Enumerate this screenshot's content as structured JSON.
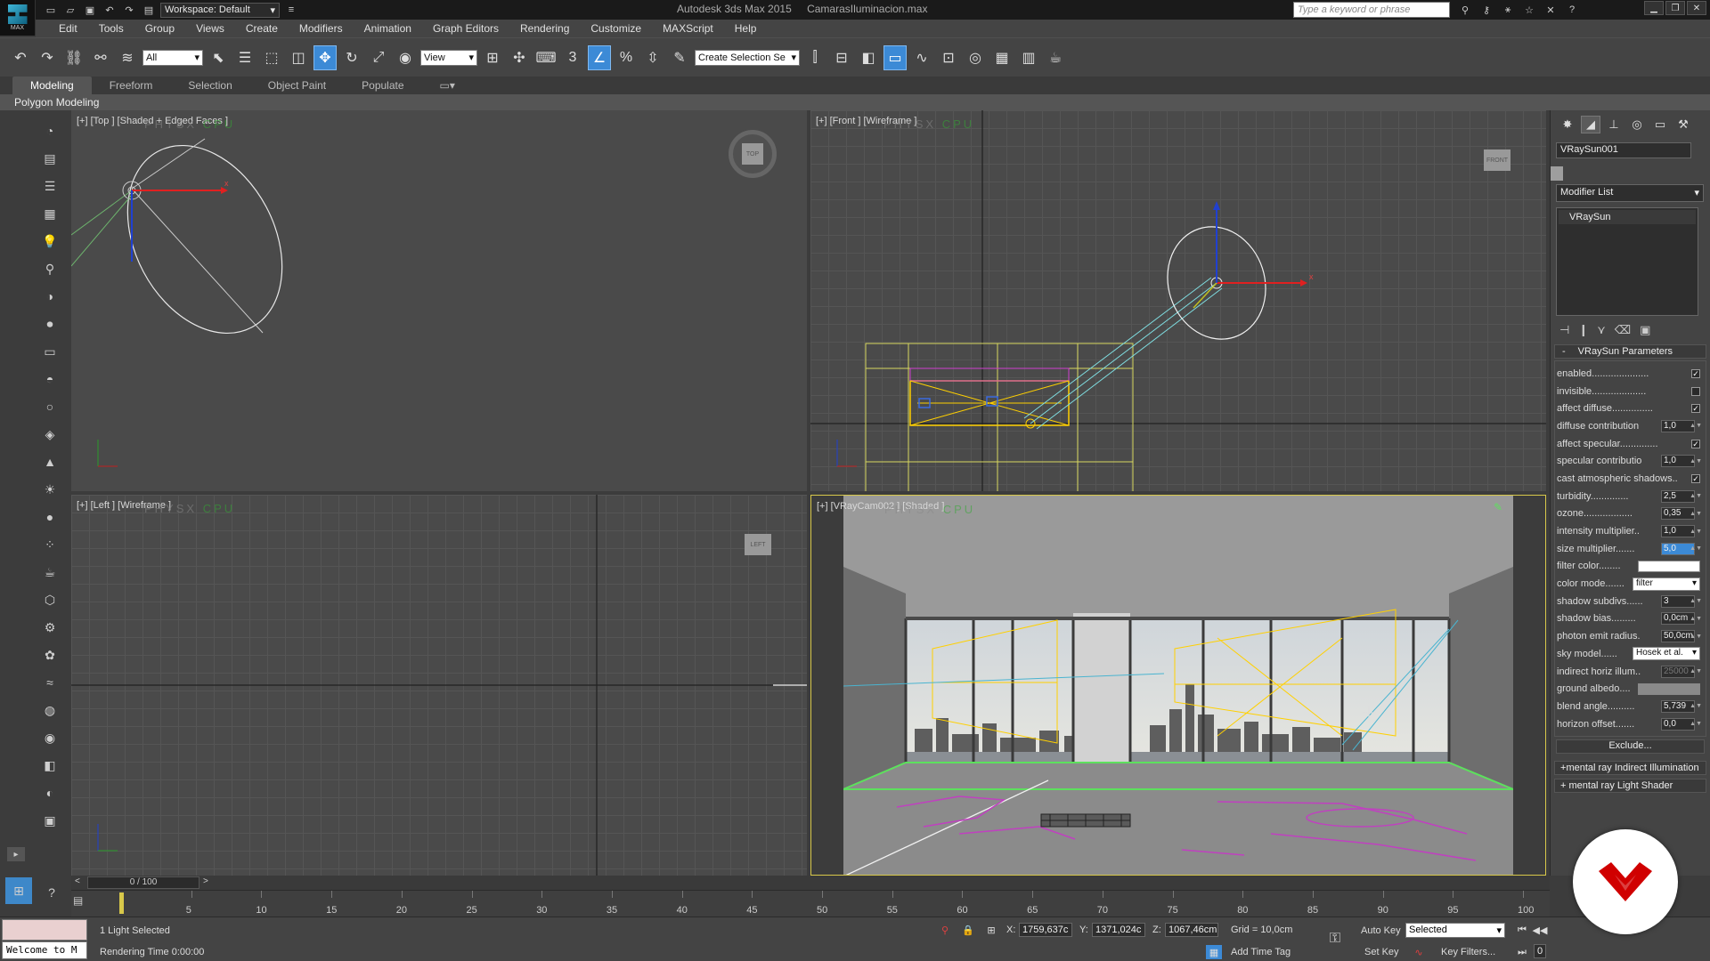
{
  "app": {
    "logo_text": "MAX",
    "title": "Autodesk 3ds Max 2015",
    "filename": "CamarasIluminacion.max",
    "workspace_label": "Workspace: Default",
    "search_placeholder": "Type a keyword or phrase"
  },
  "menu": [
    "Edit",
    "Tools",
    "Group",
    "Views",
    "Create",
    "Modifiers",
    "Animation",
    "Graph Editors",
    "Rendering",
    "Customize",
    "MAXScript",
    "Help"
  ],
  "toolbar": {
    "selection_filter": "All",
    "ref_coord": "View",
    "named_selection": "Create Selection Se"
  },
  "ribbon": {
    "tabs": [
      "Modeling",
      "Freeform",
      "Selection",
      "Object Paint",
      "Populate"
    ],
    "active_tab": "Modeling",
    "panel_label": "Polygon Modeling"
  },
  "viewports": {
    "top": {
      "label": "[+] [Top ] [Shaded + Edged Faces ]",
      "cube": "TOP"
    },
    "front": {
      "label": "[+] [Front ] [Wireframe ]",
      "cube": "FRONT"
    },
    "left": {
      "label": "[+] [Left ] [Wireframe ]",
      "cube": "LEFT"
    },
    "camera": {
      "label": "[+] [VRayCam002 ] [Shaded ]"
    },
    "physx_text": "PHYSX",
    "physx_cpu": "CPU"
  },
  "command_panel": {
    "object_name": "VRaySun001",
    "modifier_list": "Modifier List",
    "stack_item": "VRaySun",
    "rollout_title": "VRaySun Parameters",
    "params": [
      {
        "label": "enabled.....................",
        "type": "check",
        "checked": true
      },
      {
        "label": "invisible....................",
        "type": "check",
        "checked": false
      },
      {
        "label": "affect diffuse...............",
        "type": "check",
        "checked": true
      },
      {
        "label": "diffuse contribution",
        "type": "spin",
        "value": "1,0"
      },
      {
        "label": "affect specular..............",
        "type": "check",
        "checked": true
      },
      {
        "label": "specular contributio",
        "type": "spin",
        "value": "1,0"
      },
      {
        "label": "cast atmospheric shadows..",
        "type": "check",
        "checked": true
      },
      {
        "label": "turbidity..............",
        "type": "spin",
        "value": "2,5"
      },
      {
        "label": "ozone..................",
        "type": "spin",
        "value": "0,35"
      },
      {
        "label": "intensity multiplier..",
        "type": "spin",
        "value": "1,0"
      },
      {
        "label": "size multiplier.......",
        "type": "spin",
        "value": "5,0",
        "highlight": true
      },
      {
        "label": "filter color........",
        "type": "swatch",
        "color": "#ffffff"
      },
      {
        "label": "color mode.......",
        "type": "dropdown",
        "value": "filter"
      },
      {
        "label": "shadow subdivs......",
        "type": "spin",
        "value": "3"
      },
      {
        "label": "shadow bias.........",
        "type": "spin",
        "value": "0,0cm"
      },
      {
        "label": "photon emit radius.",
        "type": "spin",
        "value": "50,0cm"
      },
      {
        "label": "sky model......",
        "type": "dropdown",
        "value": "Hosek et al."
      },
      {
        "label": "indirect horiz illum..",
        "type": "spin",
        "value": "25000",
        "dim": true
      },
      {
        "label": "ground albedo....",
        "type": "swatch",
        "color": "#8a8a8a"
      },
      {
        "label": "blend angle..........",
        "type": "spin",
        "value": "5,739"
      },
      {
        "label": "horizon offset.......",
        "type": "spin",
        "value": "0,0"
      }
    ],
    "exclude_label": "Exclude...",
    "subrollouts": [
      "mental ray Indirect Illumination",
      "mental ray Light Shader"
    ]
  },
  "timeline": {
    "frame_display": "0 / 100",
    "ticks": [
      5,
      10,
      15,
      20,
      25,
      30,
      35,
      40,
      45,
      50,
      55,
      60,
      65,
      70,
      75,
      80,
      85,
      90,
      95,
      100
    ]
  },
  "status": {
    "maxscript_text": "Welcome to M",
    "selection": "1 Light Selected",
    "render_time": "Rendering Time  0:00:00",
    "x_label": "X:",
    "x": "1759,637c",
    "y_label": "Y:",
    "y": "1371,024c",
    "z_label": "Z:",
    "z": "1067,46cm",
    "grid": "Grid = 10,0cm",
    "add_time_tag": "Add Time Tag",
    "auto_key": "Auto Key",
    "set_key": "Set Key",
    "key_mode": "Selected",
    "key_filters": "Key Filters...",
    "current_frame": "0"
  }
}
